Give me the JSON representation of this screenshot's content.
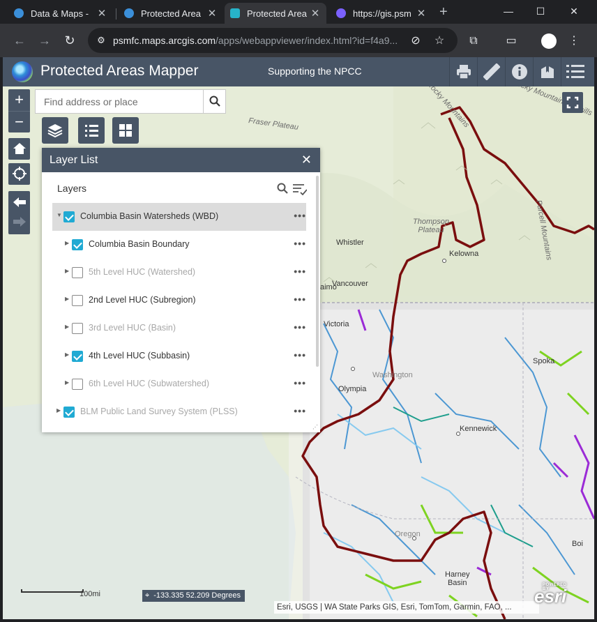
{
  "browser": {
    "tabs": [
      {
        "title": "Data & Maps -",
        "favicon_color": "#3b8fd9",
        "active": false
      },
      {
        "title": "Protected Area",
        "favicon_color": "#3b8fd9",
        "active": false
      },
      {
        "title": "Protected Area",
        "favicon_color": "#27b3c9",
        "active": true
      },
      {
        "title": "https://gis.psm",
        "favicon_color": "#7b61ff",
        "active": false
      }
    ],
    "url_host": "psmfc.maps.arcgis.com",
    "url_path": "/apps/webappviewer/index.html?id=f4a9...",
    "icons": [
      "back-icon",
      "forward-icon",
      "reload-icon",
      "site-info-icon",
      "eye-off-icon",
      "star-icon",
      "extensions-icon",
      "cast-icon",
      "profile-icon",
      "menu-icon"
    ]
  },
  "app": {
    "title": "Protected Areas Mapper",
    "subtitle": "Supporting the NPCC",
    "header_tools": [
      "print-icon",
      "measure-icon",
      "info-icon",
      "bookmark-icon",
      "menu-list-icon"
    ],
    "brand_color": "#485566"
  },
  "search": {
    "placeholder": "Find address or place"
  },
  "layer_list": {
    "title": "Layer List",
    "section_label": "Layers",
    "layers": [
      {
        "name": "Columbia Basin Watersheds (WBD)",
        "checked": true,
        "dimmed": false,
        "level": 0,
        "expanded": true,
        "selected": true
      },
      {
        "name": "Columbia Basin Boundary",
        "checked": true,
        "dimmed": false,
        "level": 1,
        "expanded": false,
        "selected": false
      },
      {
        "name": "5th Level HUC (Watershed)",
        "checked": false,
        "dimmed": true,
        "level": 1,
        "expanded": false,
        "selected": false
      },
      {
        "name": "2nd Level HUC (Subregion)",
        "checked": false,
        "dimmed": false,
        "level": 1,
        "expanded": false,
        "selected": false
      },
      {
        "name": "3rd Level HUC (Basin)",
        "checked": false,
        "dimmed": true,
        "level": 1,
        "expanded": false,
        "selected": false
      },
      {
        "name": "4th Level HUC (Subbasin)",
        "checked": true,
        "dimmed": false,
        "level": 1,
        "expanded": false,
        "selected": false
      },
      {
        "name": "6th Level HUC (Subwatershed)",
        "checked": false,
        "dimmed": true,
        "level": 1,
        "expanded": false,
        "selected": false
      },
      {
        "name": "BLM Public Land Survey System (PLSS)",
        "checked": true,
        "dimmed": true,
        "level": 0,
        "expanded": false,
        "selected": false
      }
    ],
    "more_label": "•••",
    "accent": "#20aad3"
  },
  "map": {
    "labels": {
      "fraser_plateau": "Fraser Plateau",
      "rocky_mountains": "Rocky Mountains",
      "rocky_mountain_foothills": "Rocky Mountain Foothills",
      "thompson_plateau": "Thompson\nPlateau",
      "purcell_mountains": "Purcell Mountains",
      "whistler": "Whistler",
      "kelowna": "Kelowna",
      "vancouver": "Vancouver",
      "naimo": "aimo",
      "victoria": "Victoria",
      "olympia": "Olympia",
      "washington": "Washington",
      "spokane": "Spoka",
      "kennewick": "Kennewick",
      "oregon": "Oregon",
      "harney_basin": "Harney\nBasin",
      "boise": "Boi"
    },
    "scale_label": "100mi",
    "coordinates": "-133.335 52.209 Degrees",
    "attribution": "Esri, USGS | WA State Parks GIS, Esri, TomTom, Garmin, FAO, ...",
    "esri_logo": "esri",
    "esri_powered": "POWERED BY",
    "boundary_color": "#7a0e0e"
  }
}
